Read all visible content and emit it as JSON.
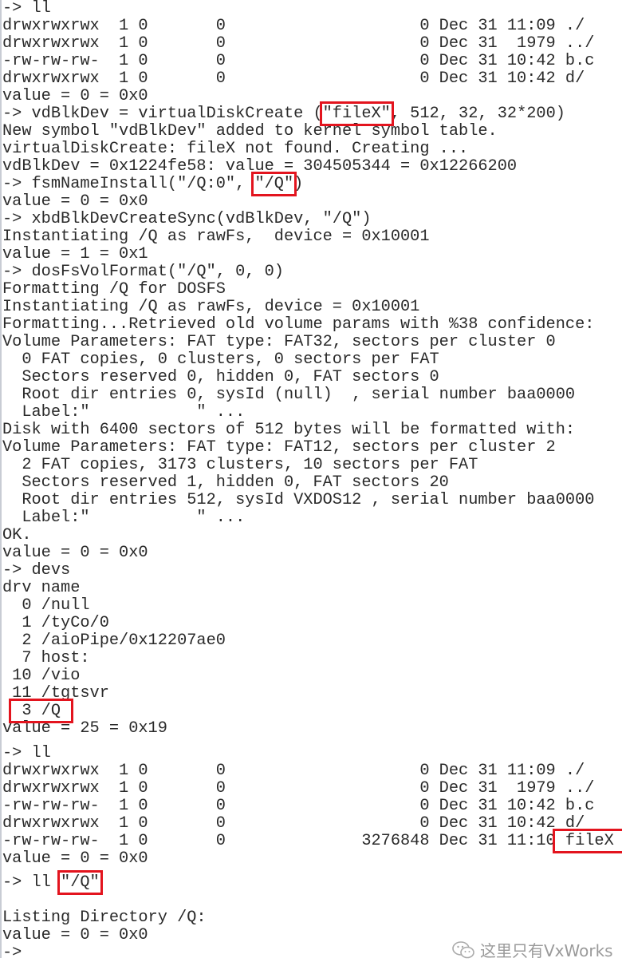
{
  "terminal": {
    "segments": [
      [
        "-> ll",
        "drwxrwxrwx  1 0       0                    0 Dec 31 11:09 ./",
        "drwxrwxrwx  1 0       0                    0 Dec 31  1979 ../",
        "-rw-rw-rw-  1 0       0                    0 Dec 31 10:42 b.c",
        "drwxrwxrwx  1 0       0                    0 Dec 31 10:42 d/",
        "value = 0 = 0x0",
        {
          "pre": "-> vdBlkDev = virtualDiskCreate (",
          "hl": "\"fileX\"",
          "post": ", 512, 32, 32*200)"
        },
        "New symbol \"vdBlkDev\" added to kernel symbol table.",
        "virtualDiskCreate: fileX not found. Creating ...",
        "vdBlkDev = 0x1224fe58: value = 304505344 = 0x12266200",
        {
          "pre": "-> fsmNameInstall(\"/Q:0\", ",
          "hl": "\"/Q\"",
          "post": ")"
        },
        "value = 0 = 0x0",
        "-> xbdBlkDevCreateSync(vdBlkDev, \"/Q\")",
        "Instantiating /Q as rawFs,  device = 0x10001",
        "value = 1 = 0x1",
        "-> dosFsVolFormat(\"/Q\", 0, 0)",
        "Formatting /Q for DOSFS",
        "Instantiating /Q as rawFs, device = 0x10001",
        "Formatting...Retrieved old volume params with %38 confidence:",
        "Volume Parameters: FAT type: FAT32, sectors per cluster 0",
        "  0 FAT copies, 0 clusters, 0 sectors per FAT",
        "  Sectors reserved 0, hidden 0, FAT sectors 0",
        "  Root dir entries 0, sysId (null)  , serial number baa0000",
        "  Label:\"           \" ...",
        "Disk with 6400 sectors of 512 bytes will be formatted with:",
        "Volume Parameters: FAT type: FAT12, sectors per cluster 2",
        "  2 FAT copies, 3173 clusters, 10 sectors per FAT",
        "  Sectors reserved 1, hidden 0, FAT sectors 20",
        "  Root dir entries 512, sysId VXDOS12 , serial number baa0000",
        "  Label:\"           \" ...",
        "OK.",
        "value = 0 = 0x0",
        "-> devs",
        "drv name",
        "  0 /null",
        "  1 /tyCo/0",
        "  2 /aioPipe/0x12207ae0",
        "  7 host:",
        " 10 /vio",
        " 11 /tgtsvr",
        {
          "pre": " ",
          "hl": " 3 /Q ",
          "post": ""
        },
        "value = 25 = 0x19"
      ],
      [
        "-> ll",
        "drwxrwxrwx  1 0       0                    0 Dec 31 11:09 ./",
        "drwxrwxrwx  1 0       0                    0 Dec 31  1979 ../",
        "-rw-rw-rw-  1 0       0                    0 Dec 31 10:42 b.c",
        "drwxrwxrwx  1 0       0                    0 Dec 31 10:42 d/",
        {
          "pre": "-rw-rw-rw-  1 0       0              3276848 Dec 31 11:10",
          "hl": " fileX ",
          "post": ""
        },
        "value = 0 = 0x0"
      ],
      [
        {
          "pre": "-> ll ",
          "hl": "\"/Q\"",
          "post": ""
        },
        "",
        "Listing Directory /Q:",
        "value = 0 = 0x0",
        "->"
      ]
    ]
  },
  "watermark": {
    "icon": "wechat-icon",
    "text": "这里只有VxWorks"
  },
  "colors": {
    "highlight_box": "#e3141e",
    "text": "#2a2a2a"
  }
}
